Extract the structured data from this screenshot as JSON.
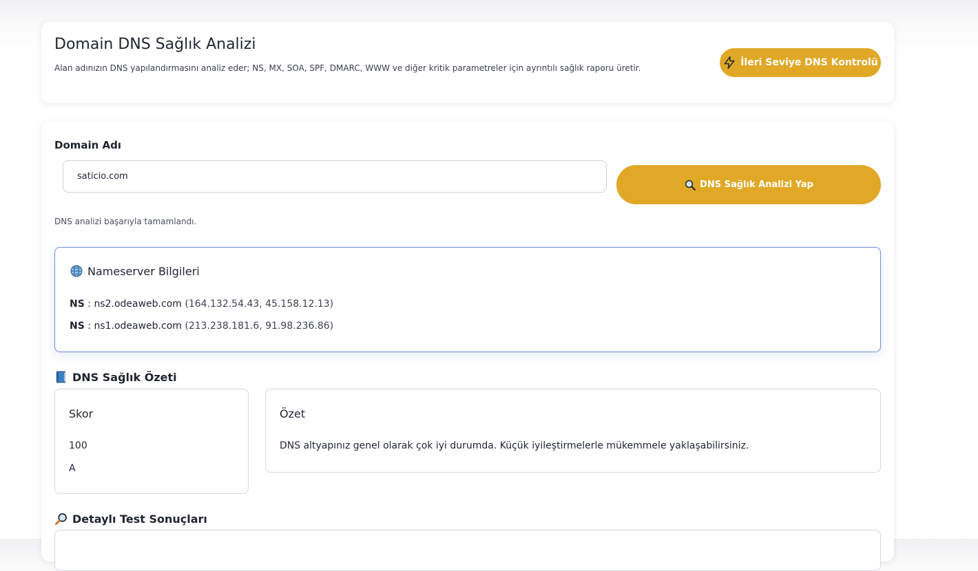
{
  "header": {
    "title": "Domain DNS Sağlık Analizi",
    "subtitle": "Alan adınızın DNS yapılandırmasını analiz eder; NS, MX, SOA, SPF, DMARC, WWW ve diğer kritik parametreler için ayrıntılı sağlık raporu üretir.",
    "advanced_button_label": "İleri Seviye DNS Kontrolü"
  },
  "form": {
    "label": "Domain Adı",
    "domain_value": "saticio.com",
    "analyze_button_label": "DNS Sağlık Analizi Yap",
    "status": "DNS analizi başarıyla tamamlandı."
  },
  "nameservers": {
    "title": "Nameserver Bilgileri",
    "records": [
      {
        "key": "NS",
        "host": "ns2.odeaweb.com",
        "ips": "(164.132.54.43, 45.158.12.13)"
      },
      {
        "key": "NS",
        "host": "ns1.odeaweb.com",
        "ips": "(213.238.181.6, 91.98.236.86)"
      }
    ]
  },
  "summary": {
    "heading": "DNS Sağlık Özeti",
    "score_title": "Skor",
    "score_value": "100",
    "grade": "A",
    "summary_title": "Özet",
    "summary_text": "DNS altyapınız genel olarak çok iyi durumda. Küçük iyileştirmelerle mükemmele yaklaşabilirsiniz."
  },
  "details": {
    "heading": "Detaylı Test Sonuçları"
  },
  "colors": {
    "accent": "#e0a826",
    "ns_border": "#6f8ed6"
  },
  "icons": {
    "advanced": "lightning-icon",
    "analyze": "magnifier-icon",
    "nameserver": "globe-icon",
    "summary": "book-icon",
    "details": "magnifier-icon"
  }
}
